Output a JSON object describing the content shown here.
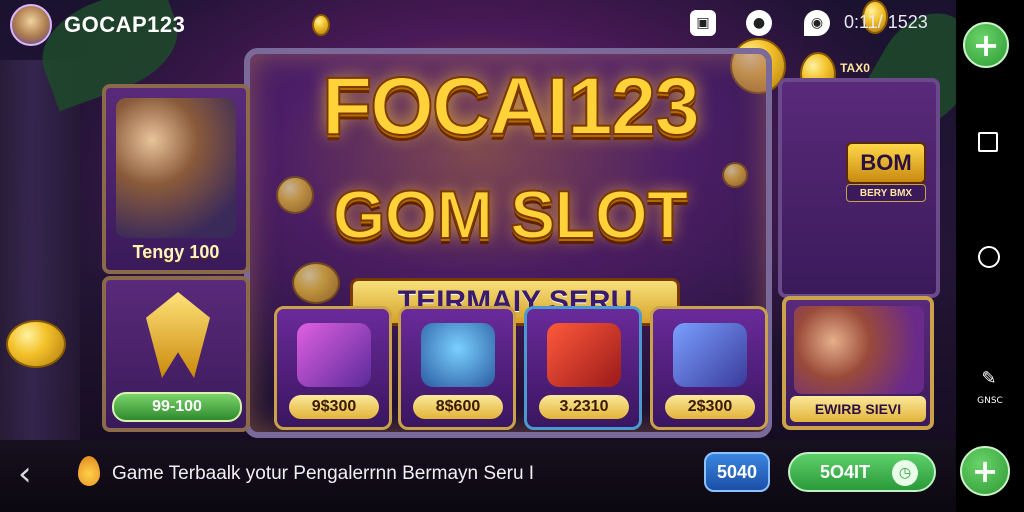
{
  "header": {
    "brand": "GOCAP123",
    "clock": "0:11/ 1523"
  },
  "hero": {
    "title": "FOCAI123",
    "subtitle": "GOM SLOT",
    "ribbon": "TEIRMAIY SERU"
  },
  "left_panel": {
    "character_label": "Tengy 100",
    "bonus_value": "99-100"
  },
  "top_right_badge": "TAX0",
  "right_panel": {
    "box_title": "BOM",
    "box_sub": "BERY BMX",
    "character_label": "EWIRB SIEVI"
  },
  "cards": [
    {
      "value": "9$300"
    },
    {
      "value": "8$600"
    },
    {
      "value": "3.2310"
    },
    {
      "value": "2$300"
    }
  ],
  "footer": {
    "ticker": "Game Terbaalk yotur Pengalerrnn Bermayn Seru I",
    "btn_blue": "5040",
    "btn_green": "5O4IT"
  },
  "sysnav": {
    "edit_label": "GNSC"
  }
}
